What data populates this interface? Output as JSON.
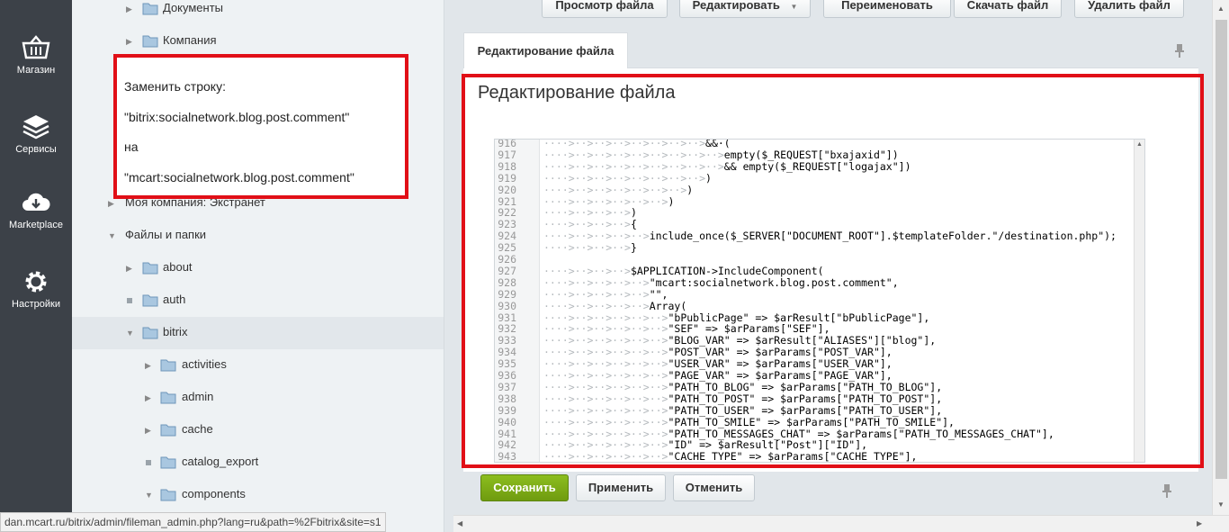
{
  "leftmenu": {
    "items": [
      {
        "label": "Магазин",
        "icon": "basket-icon"
      },
      {
        "label": "Сервисы",
        "icon": "layers-icon"
      },
      {
        "label": "Marketplace",
        "icon": "cloud-download-icon"
      },
      {
        "label": "Настройки",
        "icon": "gear-icon"
      }
    ]
  },
  "tree": {
    "rows": [
      {
        "label": "Документы"
      },
      {
        "label": "Компания"
      },
      {
        "label": "Моя компания: Экстранет"
      },
      {
        "label": "Файлы и папки"
      },
      {
        "label": "about"
      },
      {
        "label": "auth"
      },
      {
        "label": "bitrix"
      },
      {
        "label": "activities"
      },
      {
        "label": "admin"
      },
      {
        "label": "cache"
      },
      {
        "label": "catalog_export"
      },
      {
        "label": "components"
      }
    ]
  },
  "note": {
    "line1": "Заменить строку:",
    "line2": "\"bitrix:socialnetwork.blog.post.comment\"",
    "line3": "на",
    "line4": "\"mcart:socialnetwork.blog.post.comment\""
  },
  "toolbar": {
    "view": "Просмотр файла",
    "edit": "Редактировать",
    "rename": "Переименовать",
    "download": "Скачать файл",
    "delete": "Удалить файл"
  },
  "tab": {
    "label": "Редактирование файла"
  },
  "panel": {
    "title": "Редактирование файла"
  },
  "code": {
    "lines": [
      {
        "n": "916",
        "ws": "····>··>··>··>··>··>··>··>",
        "t": "&&·("
      },
      {
        "n": "917",
        "ws": "····>··>··>··>··>··>··>··>··>",
        "t": "empty($_REQUEST[\"bxajaxid\"])"
      },
      {
        "n": "918",
        "ws": "····>··>··>··>··>··>··>··>··>",
        "t": "&& empty($_REQUEST[\"logajax\"])"
      },
      {
        "n": "919",
        "ws": "····>··>··>··>··>··>··>··>",
        "t": ")"
      },
      {
        "n": "920",
        "ws": "····>··>··>··>··>··>··>",
        "t": ")"
      },
      {
        "n": "921",
        "ws": "····>··>··>··>··>··>",
        "t": ")"
      },
      {
        "n": "922",
        "ws": "····>··>··>··>",
        "t": ")"
      },
      {
        "n": "923",
        "ws": "····>··>··>··>",
        "t": "{"
      },
      {
        "n": "924",
        "ws": "····>··>··>··>··>",
        "t": "include_once($_SERVER[\"DOCUMENT_ROOT\"].$templateFolder.\"/destination.php\");"
      },
      {
        "n": "925",
        "ws": "····>··>··>··>",
        "t": "}"
      },
      {
        "n": "926",
        "ws": "",
        "t": ""
      },
      {
        "n": "927",
        "ws": "····>··>··>··>",
        "t": "$APPLICATION->IncludeComponent("
      },
      {
        "n": "928",
        "ws": "····>··>··>··>··>",
        "t": "\"mcart:socialnetwork.blog.post.comment\","
      },
      {
        "n": "929",
        "ws": "····>··>··>··>··>",
        "t": "\"\","
      },
      {
        "n": "930",
        "ws": "····>··>··>··>··>",
        "t": "Array("
      },
      {
        "n": "931",
        "ws": "····>··>··>··>··>··>",
        "t": "\"bPublicPage\" => $arResult[\"bPublicPage\"],"
      },
      {
        "n": "932",
        "ws": "····>··>··>··>··>··>",
        "t": "\"SEF\" => $arParams[\"SEF\"],"
      },
      {
        "n": "933",
        "ws": "····>··>··>··>··>··>",
        "t": "\"BLOG_VAR\" => $arResult[\"ALIASES\"][\"blog\"],"
      },
      {
        "n": "934",
        "ws": "····>··>··>··>··>··>",
        "t": "\"POST_VAR\" => $arParams[\"POST_VAR\"],"
      },
      {
        "n": "935",
        "ws": "····>··>··>··>··>··>",
        "t": "\"USER_VAR\" => $arParams[\"USER_VAR\"],"
      },
      {
        "n": "936",
        "ws": "····>··>··>··>··>··>",
        "t": "\"PAGE_VAR\" => $arParams[\"PAGE_VAR\"],"
      },
      {
        "n": "937",
        "ws": "····>··>··>··>··>··>",
        "t": "\"PATH_TO_BLOG\" => $arParams[\"PATH_TO_BLOG\"],"
      },
      {
        "n": "938",
        "ws": "····>··>··>··>··>··>",
        "t": "\"PATH_TO_POST\" => $arParams[\"PATH_TO_POST\"],"
      },
      {
        "n": "939",
        "ws": "····>··>··>··>··>··>",
        "t": "\"PATH_TO_USER\" => $arParams[\"PATH_TO_USER\"],"
      },
      {
        "n": "940",
        "ws": "····>··>··>··>··>··>",
        "t": "\"PATH_TO_SMILE\" => $arParams[\"PATH_TO_SMILE\"],"
      },
      {
        "n": "941",
        "ws": "····>··>··>··>··>··>",
        "t": "\"PATH_TO_MESSAGES_CHAT\" => $arParams[\"PATH_TO_MESSAGES_CHAT\"],"
      },
      {
        "n": "942",
        "ws": "····>··>··>··>··>··>",
        "t": "\"ID\" => $arResult[\"Post\"][\"ID\"],"
      },
      {
        "n": "943",
        "ws": "····>··>··>··>··>··>",
        "t": "\"CACHE_TYPE\" => $arParams[\"CACHE_TYPE\"],"
      }
    ]
  },
  "buttons": {
    "save": "Сохранить",
    "apply": "Применить",
    "cancel": "Отменить"
  },
  "status": {
    "url": "dan.mcart.ru/bitrix/admin/fileman_admin.php?lang=ru&path=%2Fbitrix&site=s1"
  },
  "colors": {
    "accent_red": "#e10f17",
    "save_green": "#7aa816",
    "menu_dark": "#3c4148"
  }
}
